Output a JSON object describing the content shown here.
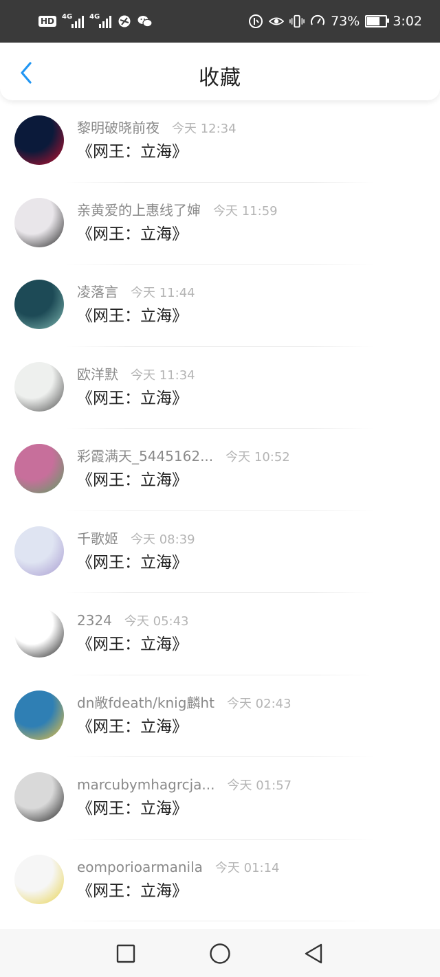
{
  "status_bar": {
    "hd_label": "HD",
    "network_1": "4G",
    "network_2": "4G",
    "battery_percent": "73%",
    "battery_level": 0.73,
    "time": "3:02",
    "icons": [
      "hd-icon",
      "signal-icon",
      "signal-icon",
      "vpn-icon",
      "wechat-icon",
      "data-saver-icon",
      "eye-comfort-icon",
      "vibrate-icon",
      "speed-icon",
      "battery-icon"
    ]
  },
  "header": {
    "title": "收藏",
    "back_icon": "chevron-left-icon",
    "accent_color": "#2196f3"
  },
  "favorites": [
    {
      "user": "黎明破晓前夜",
      "time": "今天 12:34",
      "title": "《网王：立海》",
      "avatar_colors": [
        "#0b1a3a",
        "#c8102e"
      ]
    },
    {
      "user": "亲黄爱的上惠线了婶",
      "time": "今天 11:59",
      "title": "《网王：立海》",
      "avatar_colors": [
        "#e9e6ea",
        "#222222"
      ]
    },
    {
      "user": "凌落言",
      "time": "今天 11:44",
      "title": "《网王：立海》",
      "avatar_colors": [
        "#1d4a56",
        "#7fb8b0"
      ]
    },
    {
      "user": "欧洋默",
      "time": "今天 11:34",
      "title": "《网王：立海》",
      "avatar_colors": [
        "#eef0ee",
        "#4a4a4a"
      ]
    },
    {
      "user": "彩霞满天_5445162...",
      "time": "今天 10:52",
      "title": "《网王：立海》",
      "avatar_colors": [
        "#c76f9b",
        "#5aa060"
      ]
    },
    {
      "user": "千歌姬",
      "time": "今天 08:39",
      "title": "《网王：立海》",
      "avatar_colors": [
        "#dfe4f2",
        "#a79ad0"
      ]
    },
    {
      "user": "2324",
      "time": "今天 05:43",
      "title": "《网王：立海》",
      "avatar_colors": [
        "#ffffff",
        "#1a1a1a"
      ]
    },
    {
      "user": "dn敞fdeath/knig麟ht",
      "time": "今天 02:43",
      "title": "《网王：立海》",
      "avatar_colors": [
        "#2f7fb4",
        "#f2c43a"
      ]
    },
    {
      "user": "marcubymhagrcja...",
      "time": "今天 01:57",
      "title": "《网王：立海》",
      "avatar_colors": [
        "#d9d9d9",
        "#1f1f1f"
      ]
    },
    {
      "user": "eomporioarmanila",
      "time": "今天 01:14",
      "title": "《网王：立海》",
      "avatar_colors": [
        "#f6f6f6",
        "#e8d24a"
      ]
    }
  ],
  "system_nav": {
    "icons": [
      "square-recent-icon",
      "circle-home-icon",
      "triangle-back-icon"
    ]
  }
}
